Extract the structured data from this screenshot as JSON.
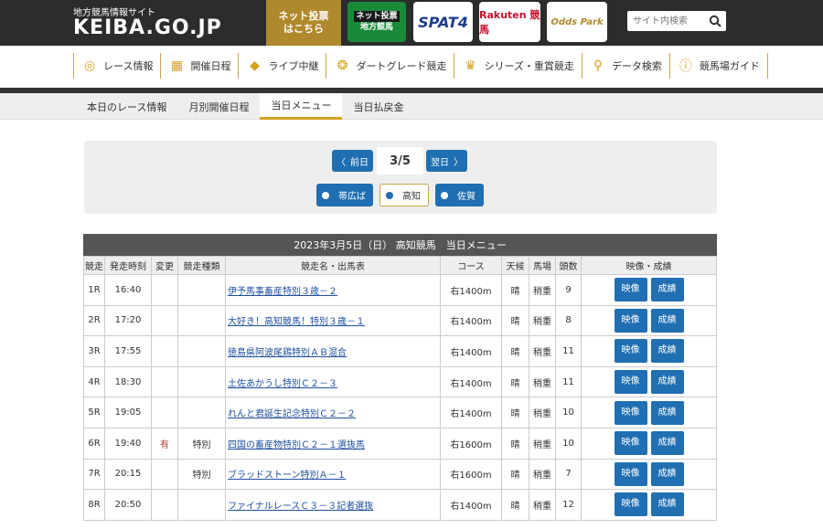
{
  "header": {
    "site_subtitle": "地方競馬情報サイト",
    "site_name": "KEIBA.GO.JP",
    "vote_button": "ネット投票\nはこちら",
    "partner_logos": [
      {
        "line1": "ネット投票",
        "line2": "地方競馬"
      },
      {
        "text": "SPAT4"
      },
      {
        "text": "Rakuten 競馬"
      },
      {
        "text": "Odds Park"
      }
    ],
    "search_placeholder": "サイト内検索"
  },
  "main_nav": [
    {
      "label": "レース情報",
      "icon": "horseshoe-icon"
    },
    {
      "label": "開催日程",
      "icon": "calendar-icon"
    },
    {
      "label": "ライブ中継",
      "icon": "ticket-icon"
    },
    {
      "label": "ダートグレード競走",
      "icon": "dirt-grade-icon"
    },
    {
      "label": "シリーズ・重賞競走",
      "icon": "trophy-icon"
    },
    {
      "label": "データ検索",
      "icon": "search-icon"
    },
    {
      "label": "競馬場ガイド",
      "icon": "info-icon"
    }
  ],
  "sub_nav": [
    {
      "label": "本日のレース情報",
      "active": false
    },
    {
      "label": "月別開催日程",
      "active": false
    },
    {
      "label": "当日メニュー",
      "active": true
    },
    {
      "label": "当日払戻金",
      "active": false
    }
  ],
  "date_panel": {
    "prev_label": "前日",
    "date": "3/5",
    "next_label": "翌日",
    "venues": [
      "帯広ば",
      "高知",
      "佐賀"
    ],
    "selected_venue": "高知"
  },
  "table": {
    "title": "2023年3月5日（日） 高知競馬　当日メニュー",
    "columns": [
      "競走",
      "発走時刻",
      "変更",
      "競走種類",
      "競走名・出馬表",
      "コース",
      "天候",
      "馬場",
      "頭数",
      "映像・成績"
    ],
    "video_label": "映像",
    "result_label": "成績",
    "rows": [
      {
        "race": "1R",
        "time": "16:40",
        "change": "",
        "type": "",
        "name": "伊予馬事畜産特別３歳－２",
        "course": "右1400m",
        "weather": "晴",
        "track": "稍重",
        "count": "9"
      },
      {
        "race": "2R",
        "time": "17:20",
        "change": "",
        "type": "",
        "name": "大好き！高知競馬！特別３歳－１",
        "course": "右1400m",
        "weather": "晴",
        "track": "稍重",
        "count": "8"
      },
      {
        "race": "3R",
        "time": "17:55",
        "change": "",
        "type": "",
        "name": "徳島県阿波尾鶏特別ＡＢ混合",
        "course": "右1400m",
        "weather": "晴",
        "track": "稍重",
        "count": "11"
      },
      {
        "race": "4R",
        "time": "18:30",
        "change": "",
        "type": "",
        "name": "土佐あかうし特別Ｃ２－３",
        "course": "右1400m",
        "weather": "晴",
        "track": "稍重",
        "count": "11"
      },
      {
        "race": "5R",
        "time": "19:05",
        "change": "",
        "type": "",
        "name": "れんと君誕生記念特別Ｃ２－２",
        "course": "右1400m",
        "weather": "晴",
        "track": "稍重",
        "count": "10"
      },
      {
        "race": "6R",
        "time": "19:40",
        "change": "有",
        "type": "特別",
        "name": "四国の畜産物特別Ｃ２－１選抜馬",
        "course": "右1600m",
        "weather": "晴",
        "track": "稍重",
        "count": "10"
      },
      {
        "race": "7R",
        "time": "20:15",
        "change": "",
        "type": "特別",
        "name": "ブラッドストーン特別Ａ－１",
        "course": "右1600m",
        "weather": "晴",
        "track": "稍重",
        "count": "7"
      },
      {
        "race": "8R",
        "time": "20:50",
        "change": "",
        "type": "",
        "name": "ファイナルレースＣ３－３記者選抜",
        "course": "右1400m",
        "weather": "晴",
        "track": "稍重",
        "count": "12"
      }
    ]
  }
}
